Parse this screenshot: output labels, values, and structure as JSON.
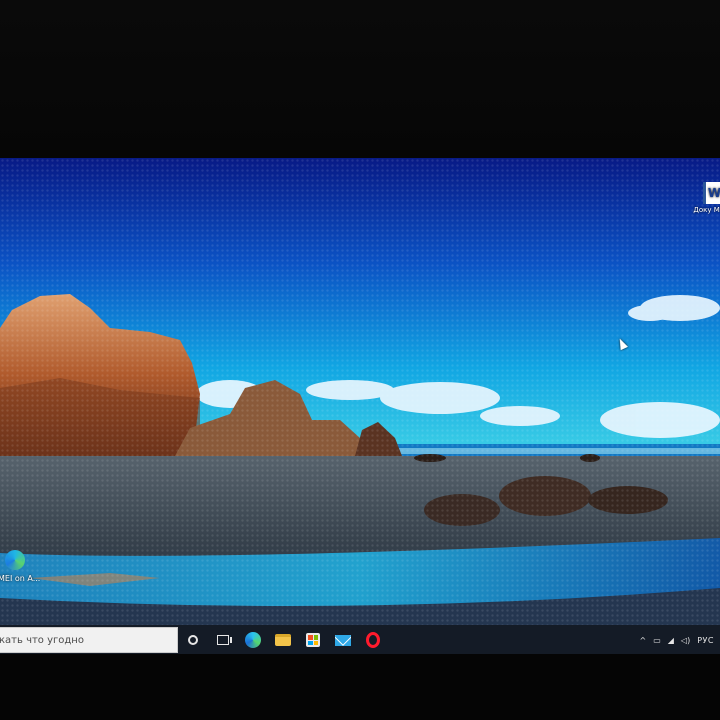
{
  "desktop": {
    "icons": [
      {
        "name": "word-document",
        "label": "Доку Micro",
        "glyph": "W"
      },
      {
        "name": "edge-shortcut",
        "label": "MEI on A..."
      }
    ]
  },
  "taskbar": {
    "search_placeholder": "кать что угодно",
    "pinned": [
      "cortana-icon",
      "task-view-icon",
      "edge-icon",
      "file-explorer-icon",
      "store-icon",
      "mail-icon",
      "opera-icon"
    ],
    "tray": {
      "chevron": "^",
      "language": "РУС"
    }
  },
  "colors": {
    "sky_top": "#0a1f8a",
    "sky_mid": "#0e7ad6",
    "horizon": "#1fc3e0",
    "sand": "#3c4652",
    "water": "#1ca6d9",
    "taskbar": "#141b26",
    "opera": "#ff1b2d"
  }
}
